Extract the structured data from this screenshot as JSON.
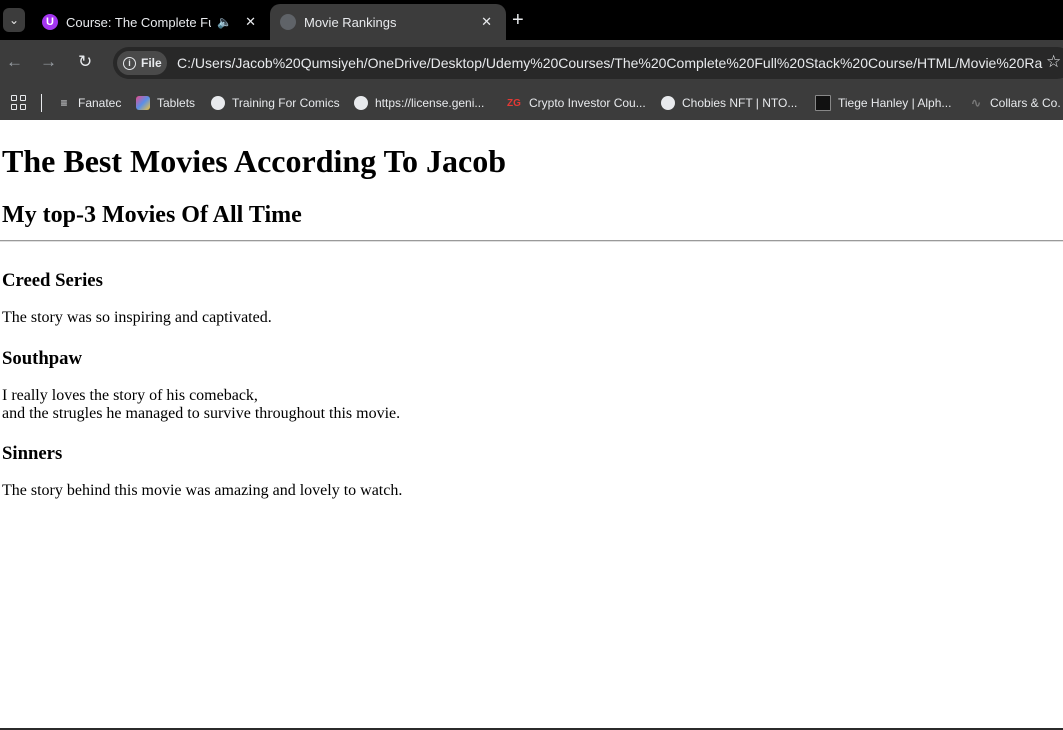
{
  "browser": {
    "tabs": [
      {
        "title": "Course: The Complete Full-S",
        "favicon": "udemy-icon",
        "favicon_text": "U",
        "audio": true
      },
      {
        "title": "Movie Rankings",
        "favicon": "globe-icon",
        "active": true
      }
    ],
    "address": {
      "chip_label": "File",
      "url": "C:/Users/Jacob%20Qumsiyeh/OneDrive/Desktop/Udemy%20Courses/The%20Complete%20Full%20Stack%20Course/HTML/Movie%20Ra..."
    },
    "bookmarks": [
      {
        "label": "Fanatec",
        "icon": "fanatec-icon"
      },
      {
        "label": "Tablets",
        "icon": "tablets-icon"
      },
      {
        "label": "Training For Comics",
        "icon": "globe-icon"
      },
      {
        "label": "https://license.geni...",
        "icon": "globe-icon"
      },
      {
        "label": "Crypto Investor Cou...",
        "icon": "zg-icon",
        "icon_text": "ZG"
      },
      {
        "label": "Chobies NFT | NTO...",
        "icon": "chobies-icon"
      },
      {
        "label": "Tiege Hanley | Alph...",
        "icon": "tiege-icon"
      },
      {
        "label": "Collars & Co.",
        "icon": "collars-icon"
      }
    ]
  },
  "page": {
    "title": "The Best Movies According To Jacob",
    "subtitle": "My top-3 Movies Of All Time",
    "movies": [
      {
        "title": "Creed Series",
        "description_lines": [
          "The story was so inspiring and captivated."
        ]
      },
      {
        "title": "Southpaw",
        "description_lines": [
          "I really loves the story of his comeback,",
          "and the strugles he managed to survive throughout this movie."
        ]
      },
      {
        "title": "Sinners",
        "description_lines": [
          "The story behind this movie was amazing and lovely to watch."
        ]
      }
    ]
  }
}
